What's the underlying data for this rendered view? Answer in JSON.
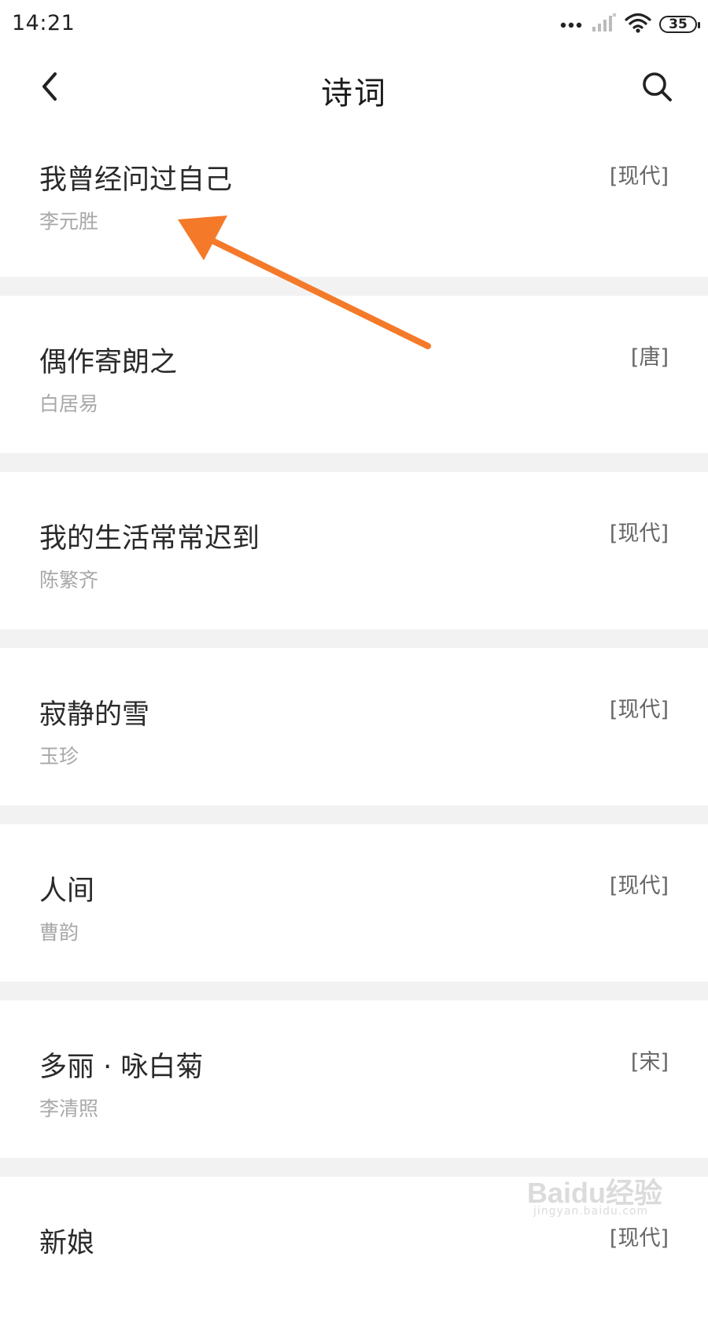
{
  "status_bar": {
    "time": "14:21",
    "battery": "35",
    "icons": [
      "dots-icon",
      "signal-icon",
      "wifi-icon",
      "battery-icon"
    ]
  },
  "nav": {
    "title": "诗词",
    "back_icon": "chevron-left-icon",
    "search_icon": "search-icon"
  },
  "poems": [
    {
      "title": "我曾经问过自己",
      "author": "李元胜",
      "era": "[现代]"
    },
    {
      "title": "偶作寄朗之",
      "author": "白居易",
      "era": "[唐]"
    },
    {
      "title": "我的生活常常迟到",
      "author": "陈繁齐",
      "era": "[现代]"
    },
    {
      "title": "寂静的雪",
      "author": "玉珍",
      "era": "[现代]"
    },
    {
      "title": "人间",
      "author": "曹韵",
      "era": "[现代]"
    },
    {
      "title": "多丽 · 咏白菊",
      "author": "李清照",
      "era": "[宋]"
    },
    {
      "title": "新娘",
      "author": "",
      "era": "[现代]"
    }
  ],
  "annotation": {
    "color": "#f47a2a"
  },
  "watermark": {
    "brand": "Baidu经验",
    "sub": "jingyan.baidu.com"
  }
}
